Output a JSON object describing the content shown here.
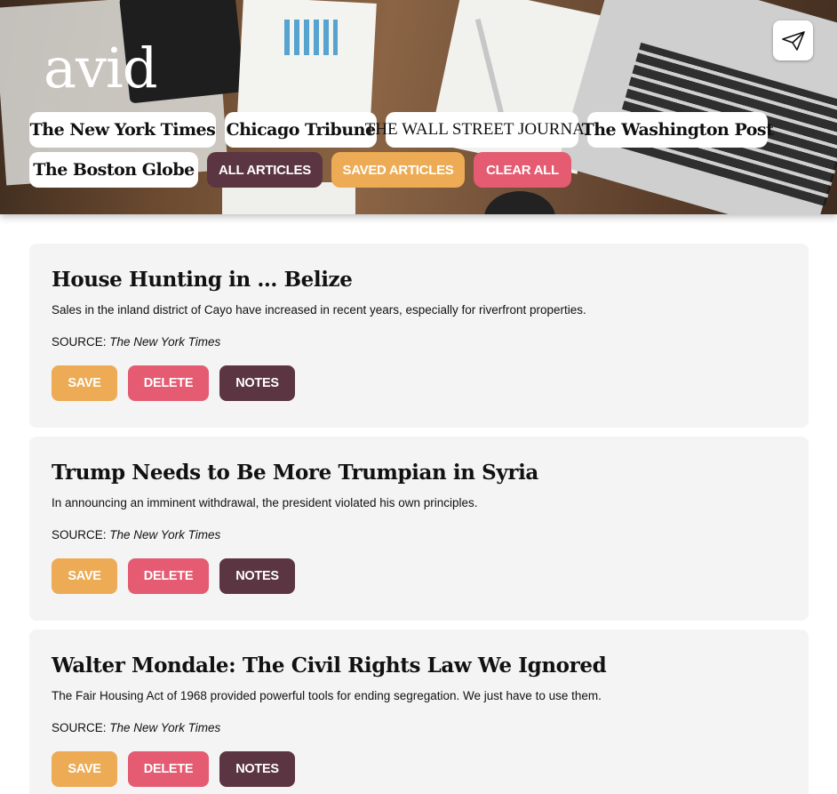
{
  "app": {
    "logo": "avid",
    "send_icon": "paper-plane-icon"
  },
  "sources": [
    {
      "label": "The New York Times"
    },
    {
      "label": "Chicago Tribune"
    },
    {
      "label": "THE WALL STREET JOURNAL."
    },
    {
      "label": "The Washington Post"
    },
    {
      "label": "The Boston Globe"
    }
  ],
  "actions": {
    "all_articles": "ALL ARTICLES",
    "saved_articles": "SAVED ARTICLES",
    "clear_all": "CLEAR ALL"
  },
  "colors": {
    "save": "#ecab54",
    "delete": "#e45b72",
    "notes": "#5b3541",
    "card_bg": "#f4f4f4"
  },
  "articles": [
    {
      "title": "House Hunting in … Belize",
      "summary": "Sales in the inland district of Cayo have increased in recent years, especially for riverfront properties.",
      "source_label": "SOURCE:",
      "source": "The New York Times",
      "save": "SAVE",
      "delete": "DELETE",
      "notes": "NOTES"
    },
    {
      "title": "Trump Needs to Be More Trumpian in Syria",
      "summary": "In announcing an imminent withdrawal, the president violated his own principles.",
      "source_label": "SOURCE:",
      "source": "The New York Times",
      "save": "SAVE",
      "delete": "DELETE",
      "notes": "NOTES"
    },
    {
      "title": "Walter Mondale: The Civil Rights Law We Ignored",
      "summary": "The Fair Housing Act of 1968 provided powerful tools for ending segregation. We just have to use them.",
      "source_label": "SOURCE:",
      "source": "The New York Times",
      "save": "SAVE",
      "delete": "DELETE",
      "notes": "NOTES"
    }
  ]
}
